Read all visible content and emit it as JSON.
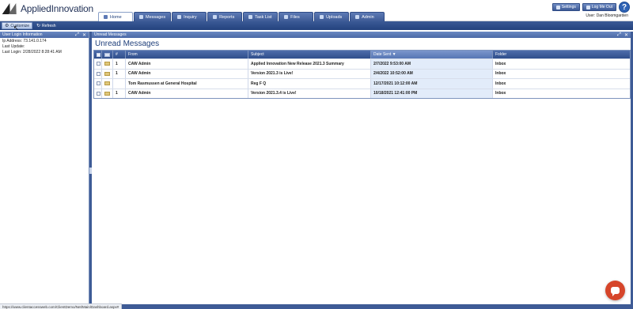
{
  "brand": {
    "name": "AppliedInnovation"
  },
  "tabs": [
    {
      "label": "Home",
      "active": true
    },
    {
      "label": "Messages",
      "active": false
    },
    {
      "label": "Inquiry",
      "active": false
    },
    {
      "label": "Reports",
      "active": false
    },
    {
      "label": "Task List",
      "active": false
    },
    {
      "label": "Files",
      "active": false
    },
    {
      "label": "Uploads",
      "active": false
    },
    {
      "label": "Admin",
      "active": false
    }
  ],
  "header": {
    "settings_label": "Settings",
    "logout_label": "Log Me Out",
    "help_label": "?",
    "user_label": "User: Dan Bloomgarden"
  },
  "toolbar": {
    "customize_label": "Customize",
    "refresh_label": "Refresh"
  },
  "left_panel": {
    "title": "User Login Information",
    "lines": [
      "Ip Address: 73.141.0.174",
      "Last Update:",
      "Last Login: 2/28/2022 8:28:41 AM"
    ]
  },
  "main_panel": {
    "header": "Unread Messages",
    "title": "Unread Messages",
    "columns": {
      "num": "#",
      "from": "From",
      "subject": "Subject",
      "date": "Date Sent ▼",
      "folder": "Folder"
    },
    "rows": [
      {
        "num": "1",
        "from": "CAW Admin",
        "subject": "Applied Innovation New Release 2021.3 Summary",
        "date": "2/7/2022 9:53:00 AM",
        "folder": "Inbox"
      },
      {
        "num": "1",
        "from": "CAW Admin",
        "subject": "Version 2021.3 is Live!",
        "date": "2/4/2022 10:52:00 AM",
        "folder": "Inbox"
      },
      {
        "num": "",
        "from": "Tom Rasmussen at General Hospital",
        "subject": "Reg F Q",
        "date": "12/17/2021 10:12:00 AM",
        "folder": "Inbox"
      },
      {
        "num": "1",
        "from": "CAW Admin",
        "subject": "Version 2021.3.4 is Live!",
        "date": "10/18/2021 12:41:00 PM",
        "folder": "Inbox"
      }
    ]
  },
  "status_bar": {
    "url": "https://www.clientaccessweb.com/ClientDemo/Net/Main/Dashboard.aspx#"
  },
  "colors": {
    "accent": "#3e5b96",
    "chat": "#d6452a"
  }
}
